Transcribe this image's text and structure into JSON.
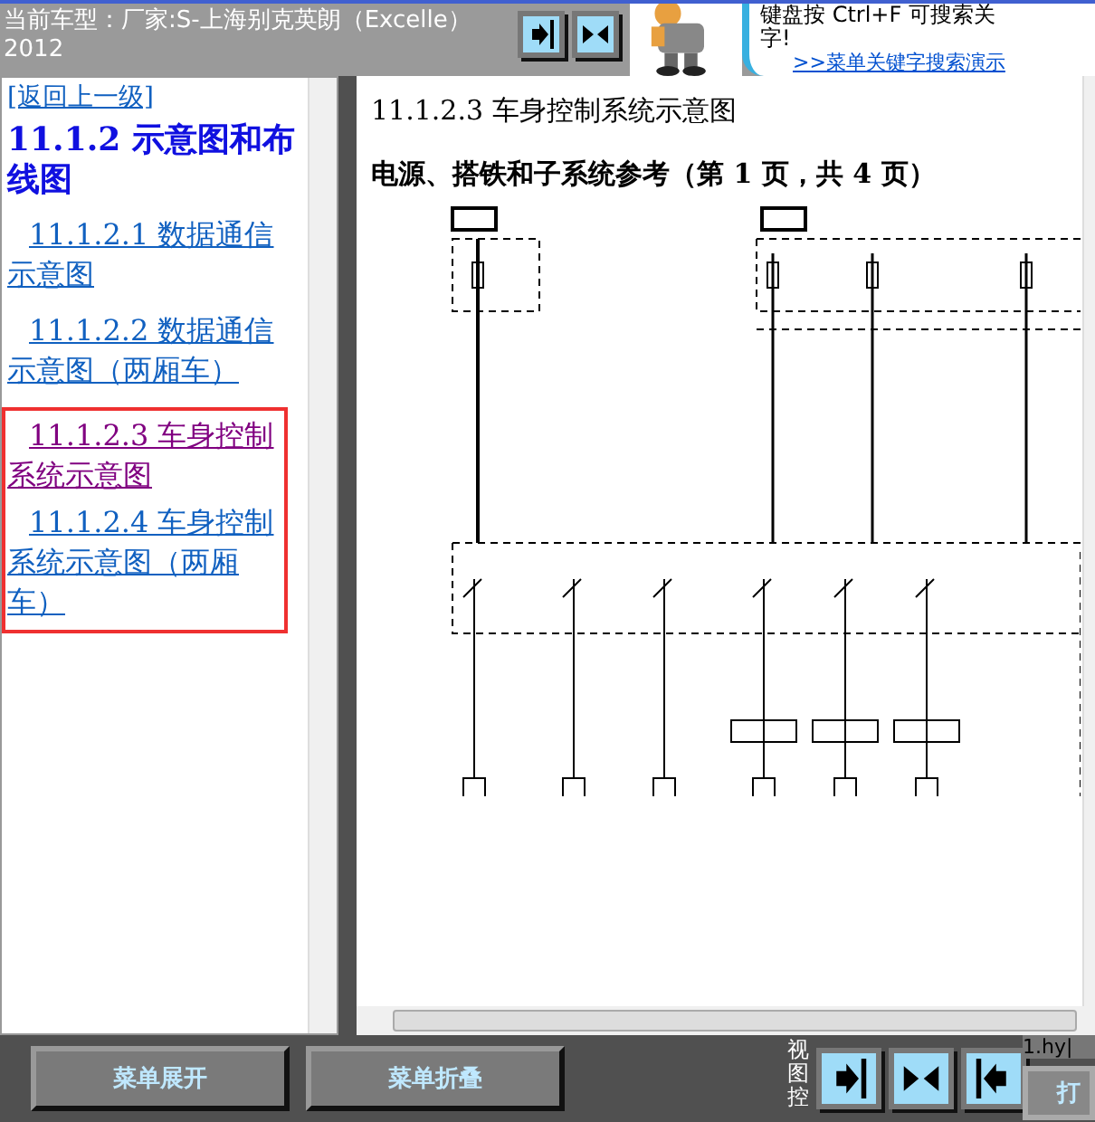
{
  "header": {
    "model_label": "当前车型：厂家:S-上海别克英朗（Excelle）2012",
    "view_buttons": [
      {
        "kind": "right"
      },
      {
        "kind": "both"
      }
    ],
    "tip_line1": "键盘按  Ctrl+F  可搜索关",
    "tip_line2": "字!",
    "tip_link": ">>菜单关键字搜索演示"
  },
  "nav": {
    "back_link": "[返回上一级]",
    "heading": "11.1.2 示意图和布线图",
    "items": [
      {
        "label": "11.1.2.1 数据通信示意图",
        "visited": false,
        "highlighted": false
      },
      {
        "label": "11.1.2.2 数据通信示意图（两厢车）",
        "visited": false,
        "highlighted": false
      },
      {
        "label": "11.1.2.3 车身控制系统示意图",
        "visited": true,
        "highlighted": true
      },
      {
        "label": "11.1.2.4 车身控制系统示意图（两厢车）",
        "visited": false,
        "highlighted": true
      }
    ]
  },
  "document": {
    "title": "11.1.2.3 车身控制系统示意图",
    "subtitle": "电源、搭铁和子系统参考（第 1 页，共 4 页）"
  },
  "footer": {
    "buttons": [
      "菜单展开",
      "菜单折叠"
    ],
    "view_label": "视图控",
    "view_buttons": [
      {
        "kind": "right"
      },
      {
        "kind": "both"
      },
      {
        "kind": "left"
      }
    ],
    "file_text": "1.hy|",
    "cut_button": "打"
  }
}
